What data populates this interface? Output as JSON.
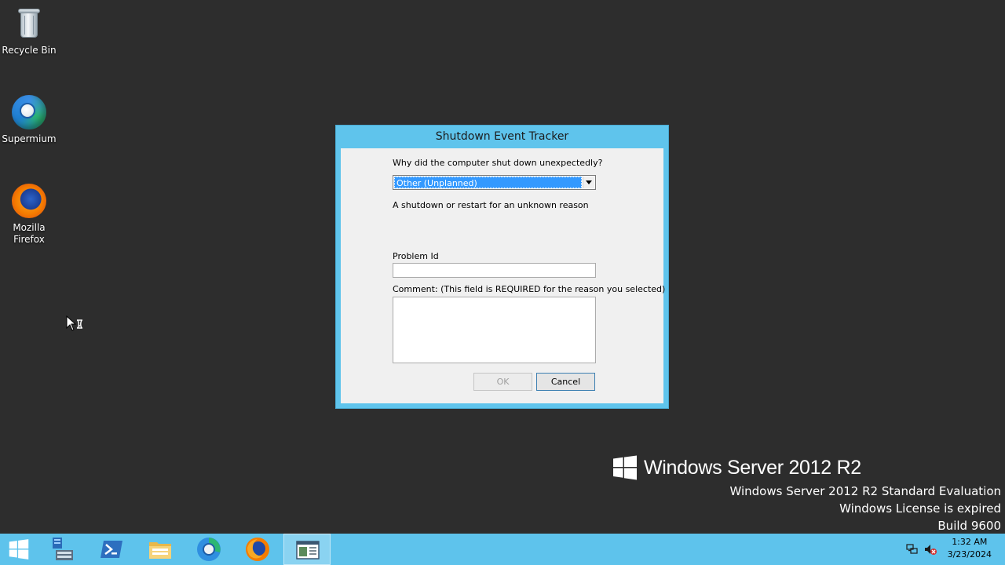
{
  "desktop": {
    "icons": [
      {
        "label": "Recycle Bin",
        "icon": "recycle-bin-icon"
      },
      {
        "label": "Supermium",
        "icon": "supermium-icon"
      },
      {
        "label": "Mozilla Firefox",
        "icon": "firefox-icon"
      }
    ]
  },
  "dialog": {
    "title": "Shutdown Event Tracker",
    "question": "Why did the computer shut down unexpectedly?",
    "reason_selected": "Other (Unplanned)",
    "reason_description": "A shutdown or restart for an unknown reason",
    "problem_id_label": "Problem Id",
    "problem_id_value": "",
    "comment_label": "Comment: (This field is REQUIRED for the reason you selected)",
    "comment_value": "",
    "ok_label": "OK",
    "cancel_label": "Cancel"
  },
  "watermark": {
    "brand": "Windows Server 2012 R2",
    "edition": "Windows Server 2012 R2 Standard Evaluation",
    "license": "Windows License is expired",
    "build": "Build 9600"
  },
  "taskbar": {
    "items": [
      {
        "icon": "start-icon"
      },
      {
        "icon": "server-manager-icon"
      },
      {
        "icon": "powershell-icon"
      },
      {
        "icon": "file-explorer-icon"
      },
      {
        "icon": "supermium-icon"
      },
      {
        "icon": "firefox-icon"
      },
      {
        "icon": "shutdown-event-tracker-icon"
      }
    ],
    "clock_time": "1:32 AM",
    "clock_date": "3/23/2024"
  },
  "colors": {
    "desktop_bg": "#2d2d2d",
    "accent": "#5ec3ec",
    "selection": "#3399ff"
  }
}
